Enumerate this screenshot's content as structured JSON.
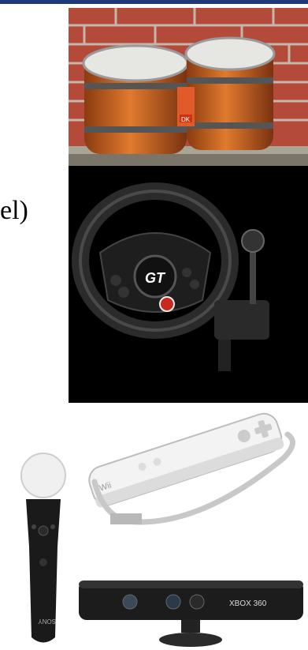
{
  "slide": {
    "fragment_text": "el)",
    "accent_bar_color": "#1f3a7a"
  },
  "photos": {
    "bongo_drums": {
      "label_text": "DK"
    },
    "racing_wheel": {
      "logo_text": "GT"
    },
    "motion_controller": {
      "brand_text": "SONY"
    },
    "wii_remote": {
      "brand_text": "Wii"
    },
    "kinect": {
      "brand_text": "XBOX 360"
    }
  }
}
